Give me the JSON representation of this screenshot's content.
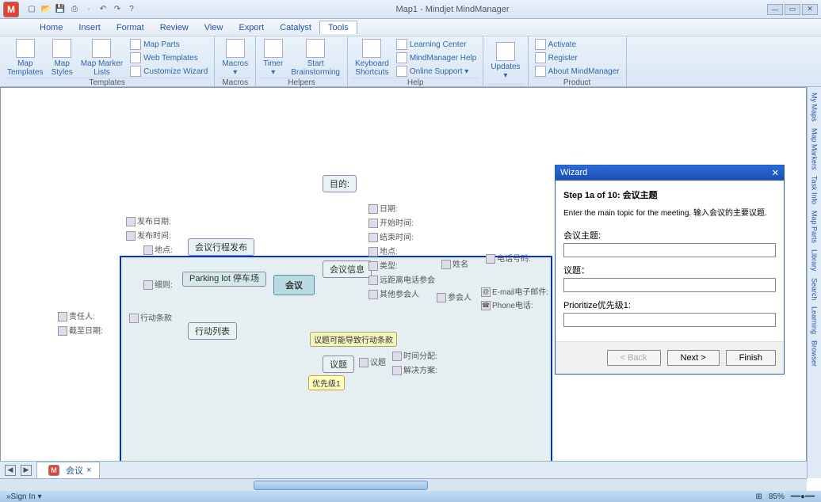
{
  "app": {
    "title": "Map1 - Mindjet MindManager",
    "logo": "M"
  },
  "qat": [
    "new",
    "open",
    "save",
    "print",
    "|",
    "undo",
    "redo",
    "|",
    "help"
  ],
  "menu": {
    "items": [
      "Home",
      "Insert",
      "Format",
      "Review",
      "View",
      "Export",
      "Catalyst",
      "Tools"
    ],
    "active": "Tools"
  },
  "ribbon": {
    "groups": [
      {
        "name": "Templates",
        "large": [
          {
            "l": "Map\nTemplates"
          },
          {
            "l": "Map\nStyles"
          },
          {
            "l": "Map Marker\nLists"
          }
        ],
        "small": [
          {
            "l": "Map Parts"
          },
          {
            "l": "Web Templates"
          },
          {
            "l": "Customize Wizard"
          }
        ]
      },
      {
        "name": "Macros",
        "large": [
          {
            "l": "Macros\n▾"
          }
        ]
      },
      {
        "name": "Helpers",
        "large": [
          {
            "l": "Timer\n▾"
          },
          {
            "l": "Start\nBrainstorming"
          }
        ]
      },
      {
        "name": "Help",
        "large": [
          {
            "l": "Keyboard\nShortcuts"
          }
        ],
        "small": [
          {
            "l": "Learning Center"
          },
          {
            "l": "MindManager Help"
          },
          {
            "l": "Online Support ▾"
          }
        ]
      },
      {
        "name": "",
        "large": [
          {
            "l": "Updates\n▾"
          }
        ]
      },
      {
        "name": "Product",
        "small": [
          {
            "l": "Activate"
          },
          {
            "l": "Register"
          },
          {
            "l": "About MindManager"
          }
        ]
      }
    ]
  },
  "side_tabs": [
    "My Maps",
    "Map Markers",
    "Task Info",
    "Map Parts",
    "Library",
    "Search",
    "Learning",
    "Browser"
  ],
  "nodes": {
    "main": "会议",
    "parking": "Parking lot\n停车场",
    "agenda": "会议行程发布",
    "info": "会议信息",
    "actions": "行动列表",
    "purpose": "目的:",
    "topic_box": "议题",
    "topic_hint": "议题可能导致行动条款",
    "priority": "优先级1",
    "details": {
      "发布日期:": "",
      "发布时间:": "",
      "地点:": "",
      "细则:": "",
      "责任人:": "",
      "截至日期:": "",
      "行动条款": ""
    },
    "info_items": [
      "日期:",
      "开始时间:",
      "结束时间:",
      "地点:",
      "类型:",
      "远距离电话参会",
      "其他参会人"
    ],
    "topic_items": [
      "时间分配:",
      "解决方案:"
    ],
    "participants": {
      "name": "姓名",
      "attendee": "参会人",
      "tel": "电话号码:",
      "email": "E-mail电子邮件:",
      "phone": "Phone电话:"
    }
  },
  "wizard": {
    "title": "Wizard",
    "step": "Step 1a of 10: 会议主题",
    "instr": "Enter the main topic for the meeting. 输入会议的主要议题.",
    "fields": [
      {
        "label": "会议主题:",
        "value": ""
      },
      {
        "label": "议题：",
        "value": ""
      },
      {
        "label": "Prioritize优先级1:",
        "value": ""
      }
    ],
    "buttons": {
      "back": "< Back",
      "next": "Next >",
      "finish": "Finish"
    }
  },
  "doc_tab": "会议",
  "status": {
    "left": "»Sign In ▾",
    "zoom": "85%",
    "ratio": ""
  }
}
